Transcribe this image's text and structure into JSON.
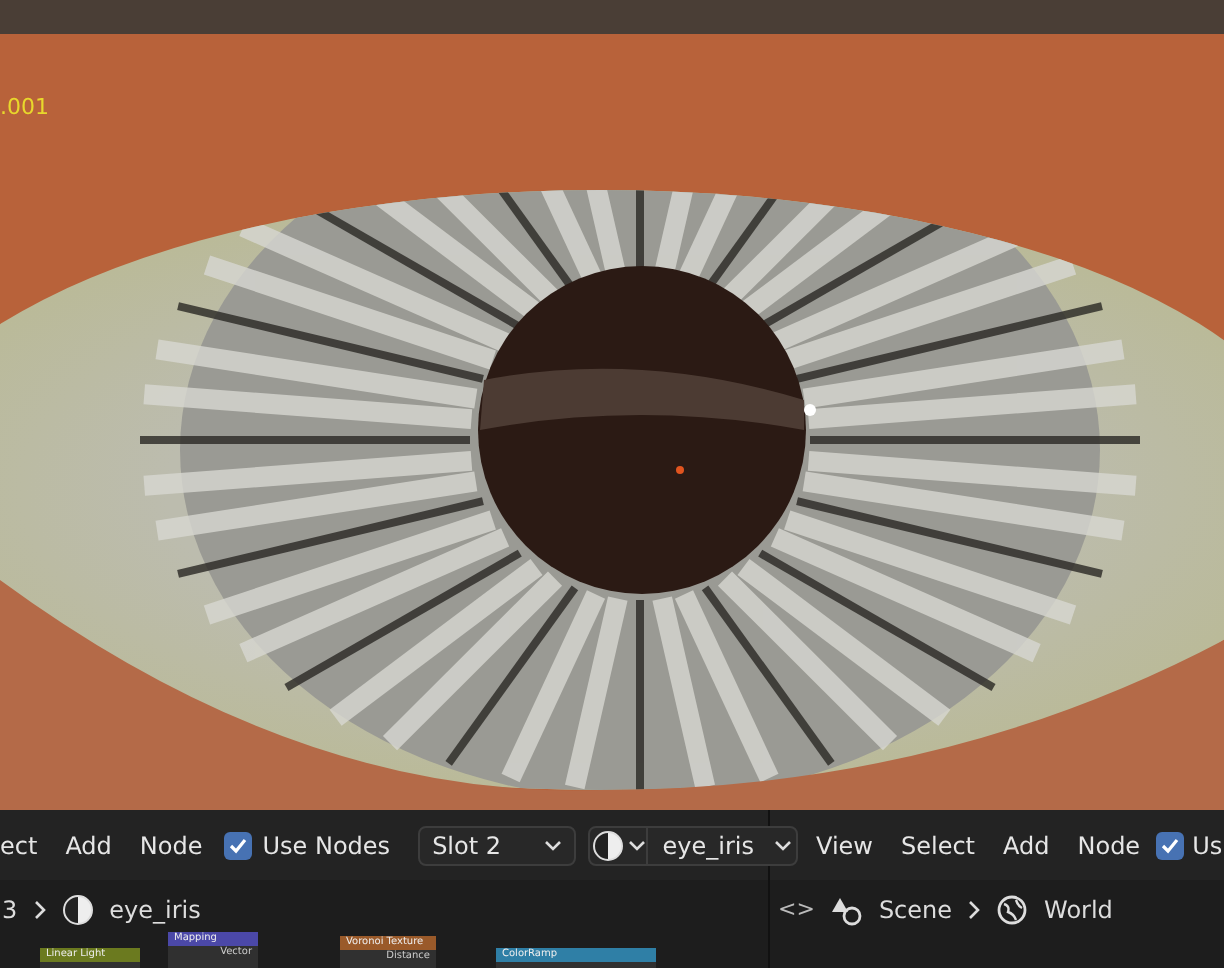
{
  "viewport": {
    "object_label": ".001"
  },
  "header": {
    "menus_left": [
      "ect",
      "Add",
      "Node"
    ],
    "use_nodes_left": {
      "label": "Use Nodes",
      "checked": true
    },
    "slot": "Slot 2",
    "material": "eye_iris",
    "menus_right": [
      "View",
      "Select",
      "Add",
      "Node"
    ],
    "use_nodes_right": {
      "label": "Us",
      "checked": true
    }
  },
  "breadcrumbs_left": {
    "prefix": "3",
    "material": "eye_iris"
  },
  "breadcrumbs_right": {
    "toggle": "<>",
    "scene": "Scene",
    "world": "World"
  },
  "nodes": [
    {
      "title": "Linear Light",
      "color": "#6b7a1f"
    },
    {
      "title": "Mapping",
      "color": "#4b48a8",
      "sockets": [
        "Vector"
      ]
    },
    {
      "title": "Voronoi Texture",
      "color": "#9a5a2a",
      "sockets": [
        "Distance"
      ]
    },
    {
      "title": "ColorRamp",
      "color": "#2f7fa6"
    }
  ]
}
